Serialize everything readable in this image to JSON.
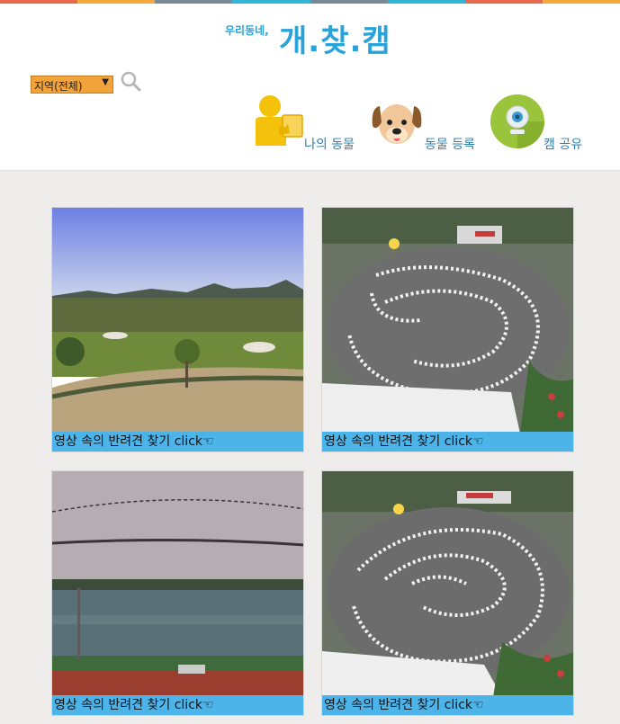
{
  "header": {
    "logo_small": "우리동네,",
    "logo_big": "개.찾.캠",
    "region_select": {
      "value": "지역(전체)"
    },
    "nav": [
      {
        "label": "나의 동물",
        "icon": "person-icon"
      },
      {
        "label": "동물 등록",
        "icon": "dog-icon"
      },
      {
        "label": "캠 공유",
        "icon": "webcam-icon"
      }
    ]
  },
  "colors": {
    "topbar": [
      "#e86a4e",
      "#f5a83c",
      "#7a8a99",
      "#33b5d6",
      "#7a8a99",
      "#33b5d6",
      "#e86a4e",
      "#f5a83c"
    ],
    "accent": "#29a3d8",
    "caption_bg": "#4db4ea",
    "select_bg": "#f2a33a"
  },
  "cams": [
    {
      "caption": "영상 속의 반려견 찾기 click☜",
      "scene": "golf-course-landscape"
    },
    {
      "caption": "영상 속의 반려견 찾기 click☜",
      "scene": "go-kart-track-aerial"
    },
    {
      "caption": "영상 속의 반려견 찾기 click☜",
      "scene": "coastal-sea-view"
    },
    {
      "caption": "영상 속의 반려견 찾기 click☜",
      "scene": "go-kart-track-aerial"
    }
  ]
}
